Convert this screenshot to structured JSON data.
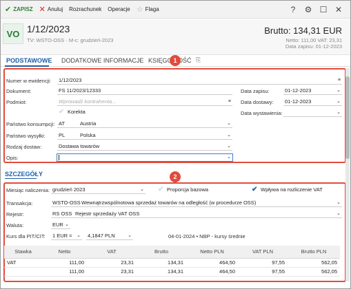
{
  "toolbar": {
    "save": "ZAPISZ",
    "cancel": "Anuluj",
    "settlement": "Rozrachunek",
    "operations": "Operacje",
    "flag": "Flaga"
  },
  "header": {
    "badge": "VO",
    "title": "1/12/2023",
    "subtitle": "TV: WSTO-OSS  ·  M-c: grudzień-2023",
    "brutto": "Brutto: 134,31 EUR",
    "netto": "Netto: 111,00 VAT: 23,31",
    "data_zapisu": "Data zapisu: 01-12-2023"
  },
  "tabs": [
    "PODSTAWOWE",
    "DODATKOWE INFORMACJE",
    "KSIĘGOWOŚĆ"
  ],
  "markers": [
    "1",
    "2"
  ],
  "basic": {
    "numer_label": "Numer w ewidencji:",
    "numer_value": "1/12/2023",
    "dokument_label": "Dokument:",
    "dokument_value": "FS 11/2023/12333",
    "podmiot_label": "Podmiot:",
    "podmiot_placeholder": "Wprowadź kontrahenta...",
    "korekta_label": "Korekta",
    "panstwo_konsumpcji_label": "Państwo konsumpcji:",
    "panstwo_konsumpcji_code": "AT",
    "panstwo_konsumpcji_name": "Austria",
    "panstwo_wysylki_label": "Państwo wysyłki:",
    "panstwo_wysylki_code": "PL",
    "panstwo_wysylki_name": "Polska",
    "rodzaj_label": "Rodzaj dostaw:",
    "rodzaj_value": "Dostawa towarów",
    "opis_label": "Opis:",
    "data_zapisu_label": "Data zapisu:",
    "data_zapisu_value": "01-12-2023",
    "data_dostawy_label": "Data dostawy:",
    "data_dostawy_value": "01-12-2023",
    "data_wystawienia_label": "Data wystawienia:"
  },
  "details": {
    "title": "SZCZEGÓŁY",
    "miesiac_label": "Miesiąc naliczenia:",
    "miesiac_value": "grudzień 2023",
    "proporcja_label": "Proporcja bazowa",
    "wplywa_label": "Wpływa na rozliczenie VAT",
    "transakcja_label": "Transakcja:",
    "transakcja_code": "WSTO-OSS",
    "transakcja_name": "Wewnątrzwspólnotowa sprzedaż towarów na odległość (w procedurze OSS)",
    "rejestr_label": "Rejestr:",
    "rejestr_code": "RS OSS",
    "rejestr_name": "Rejestr sprzedaży VAT OSS",
    "waluta_label": "Waluta:",
    "waluta_value": "EUR",
    "kurs_label": "Kurs dla PIT/CIT:",
    "kurs_eq": "1 EUR =",
    "kurs_value": "4,1847 PLN",
    "kurs_info": "04-01-2024 • NBP - kursy średnie"
  },
  "table": {
    "headers": [
      "Stawka",
      "Netto",
      "VAT",
      "Brutto",
      "Netto PLN",
      "VAT PLN",
      "Brutto PLN"
    ],
    "rows": [
      [
        "VAT",
        "111,00",
        "23,31",
        "134,31",
        "464,50",
        "97,55",
        "562,05"
      ]
    ],
    "total": [
      "",
      "111,00",
      "23,31",
      "134,31",
      "464,50",
      "97,55",
      "562,05"
    ]
  }
}
